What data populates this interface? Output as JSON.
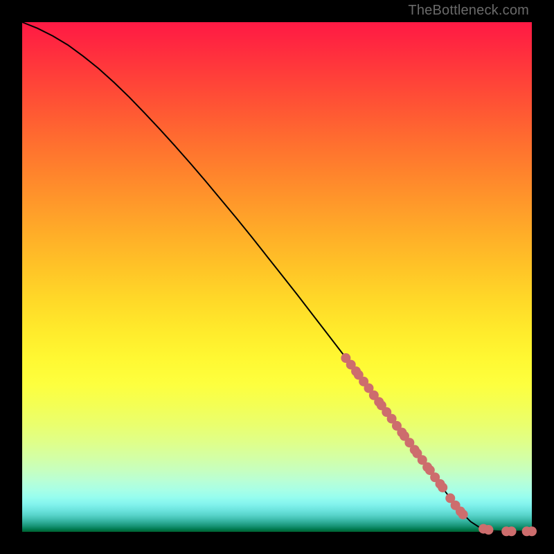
{
  "watermark": "TheBottleneck.com",
  "colors": {
    "frame": "#000000",
    "curve": "#000000",
    "dot": "#cd6d6d"
  },
  "chart_data": {
    "type": "line",
    "title": "",
    "xlabel": "",
    "ylabel": "",
    "xlim": [
      0,
      100
    ],
    "ylim": [
      0,
      100
    ],
    "grid": false,
    "curve": {
      "x": [
        0,
        3,
        6,
        9,
        12,
        15,
        18,
        21,
        24,
        27,
        30,
        33,
        36,
        39,
        42,
        45,
        48,
        51,
        54,
        57,
        60,
        63,
        66,
        69,
        72,
        75,
        78,
        81,
        84,
        86,
        88,
        90,
        92,
        94,
        96,
        98,
        100
      ],
      "y": [
        100,
        98.8,
        97.3,
        95.5,
        93.3,
        90.9,
        88.2,
        85.3,
        82.2,
        79.0,
        75.7,
        72.3,
        68.8,
        65.2,
        61.6,
        57.9,
        54.1,
        50.3,
        46.5,
        42.6,
        38.7,
        34.8,
        30.8,
        26.8,
        22.8,
        18.8,
        14.7,
        10.6,
        6.6,
        4.0,
        2.0,
        0.7,
        0.2,
        0.1,
        0.1,
        0.1,
        0.1
      ]
    },
    "series": [
      {
        "name": "data-points",
        "type": "scatter",
        "x": [
          63.5,
          64.5,
          65.5,
          66.0,
          67.0,
          68.0,
          69.0,
          70.0,
          70.5,
          71.5,
          72.5,
          73.5,
          74.5,
          75.0,
          76.0,
          77.0,
          77.5,
          78.5,
          79.5,
          80.0,
          81.0,
          82.0,
          82.5,
          84.0,
          85.0,
          86.0,
          86.5,
          90.5,
          91.5,
          95.0,
          96.0,
          99.0,
          100.0
        ],
        "y": [
          34.1,
          32.8,
          31.5,
          30.8,
          29.5,
          28.2,
          26.8,
          25.5,
          24.8,
          23.5,
          22.2,
          20.8,
          19.5,
          18.8,
          17.5,
          16.1,
          15.4,
          14.1,
          12.7,
          12.1,
          10.7,
          9.4,
          8.7,
          6.6,
          5.2,
          4.0,
          3.4,
          0.6,
          0.4,
          0.1,
          0.1,
          0.1,
          0.1
        ]
      }
    ]
  }
}
